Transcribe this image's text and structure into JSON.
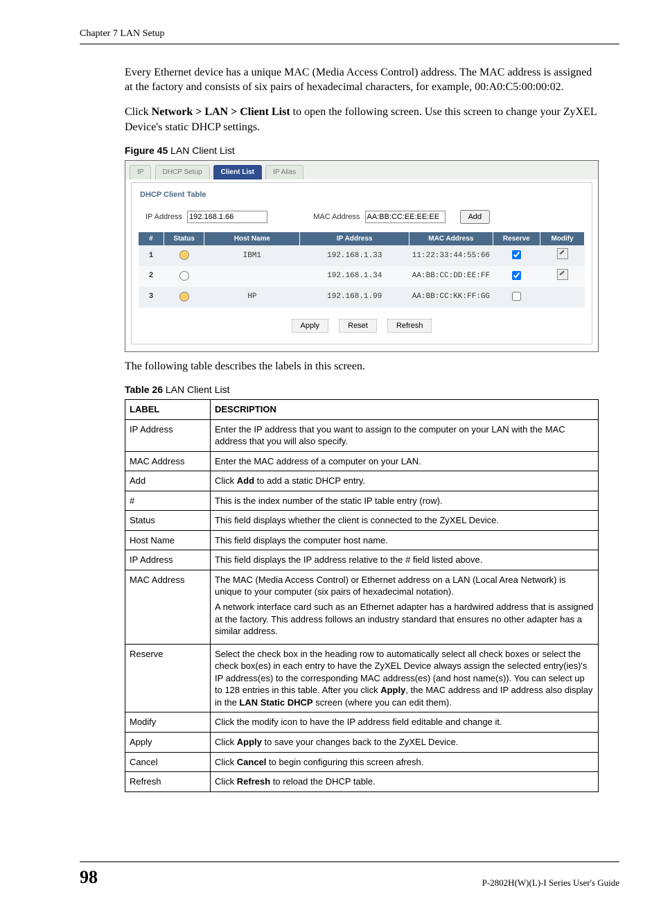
{
  "header": {
    "chapter": "Chapter 7 LAN Setup"
  },
  "paras": {
    "p1": "Every Ethernet device has a unique MAC (Media Access Control) address. The MAC address is assigned at the factory and consists of six pairs of hexadecimal characters, for example, 00:A0:C5:00:00:02.",
    "p2_pre": "Click ",
    "p2_bold": "Network > LAN > Client List",
    "p2_post": " to open the following screen. Use this screen to change your ZyXEL Device's static DHCP settings.",
    "p3": "The following table describes the labels in this screen."
  },
  "figcap": {
    "num": "Figure 45",
    "title": "   LAN Client List"
  },
  "tabs": [
    "IP",
    "DHCP Setup",
    "Client List",
    "IP Alias"
  ],
  "panel": {
    "title": "DHCP Client Table",
    "ip_label": "IP Address",
    "ip_value": "192.168.1.66",
    "mac_label": "MAC Address",
    "mac_value": "AA:BB:CC:EE:EE:EE",
    "add": "Add",
    "cols": [
      "#",
      "Status",
      "Host Name",
      "IP Address",
      "MAC Address",
      "Reserve",
      "Modify"
    ],
    "rows": [
      {
        "n": "1",
        "on": true,
        "host": "IBM1",
        "ip": "192.168.1.33",
        "mac": "11:22:33:44:55:66",
        "reserve": true,
        "modify": true
      },
      {
        "n": "2",
        "on": false,
        "host": "",
        "ip": "192.168.1.34",
        "mac": "AA:BB:CC:DD:EE:FF",
        "reserve": true,
        "modify": true
      },
      {
        "n": "3",
        "on": true,
        "host": "HP",
        "ip": "192.168.1.99",
        "mac": "AA:BB:CC:KK:FF:GG",
        "reserve": false,
        "modify": false
      }
    ],
    "btns": {
      "apply": "Apply",
      "reset": "Reset",
      "refresh": "Refresh"
    }
  },
  "tabcap": {
    "num": "Table 26",
    "title": "   LAN Client List"
  },
  "desc": {
    "head": [
      "LABEL",
      "DESCRIPTION"
    ],
    "rows": [
      {
        "label": "IP Address",
        "desc": "Enter the IP address that you want to assign to the computer on your LAN with the MAC address that you will also specify."
      },
      {
        "label": "MAC Address",
        "desc": "Enter the MAC address of a computer on your LAN."
      },
      {
        "label": "Add",
        "desc_parts": [
          "Click ",
          "Add",
          " to add a static DHCP entry."
        ]
      },
      {
        "label": "#",
        "desc": "This is the index number of the static IP table entry (row)."
      },
      {
        "label": "Status",
        "desc": "This field displays whether the client is connected to the ZyXEL Device."
      },
      {
        "label": "Host Name",
        "desc": "This field displays the computer host name."
      },
      {
        "label": "IP Address",
        "desc": "This field displays the IP address relative to the # field listed above."
      },
      {
        "label": "MAC Address",
        "desc_multi": [
          "The MAC (Media Access Control) or Ethernet address on a LAN (Local Area Network) is unique to your computer (six pairs of hexadecimal notation).",
          "A network interface card such as an Ethernet adapter has a hardwired address that is assigned at the factory. This address follows an industry standard that ensures no other adapter has a similar address."
        ]
      },
      {
        "label": "Reserve",
        "desc_parts": [
          "Select the check box in the heading row to automatically select all check boxes or select the check box(es) in each entry to have the ZyXEL Device always assign the selected entry(ies)'s IP address(es) to the corresponding MAC address(es) (and host name(s)). You can select up to 128 entries in this table. After you click ",
          "Apply",
          ", the MAC address and IP address also display in the ",
          "LAN Static DHCP",
          " screen (where you can edit them)."
        ]
      },
      {
        "label": "Modify",
        "desc": "Click the modify icon to have the IP address field editable and change it."
      },
      {
        "label": "Apply",
        "desc_parts": [
          "Click ",
          "Apply",
          " to save your changes back to the ZyXEL Device."
        ]
      },
      {
        "label": "Cancel",
        "desc_parts": [
          "Click ",
          "Cancel",
          " to begin configuring this screen afresh."
        ]
      },
      {
        "label": "Refresh",
        "desc_parts": [
          "Click ",
          "Refresh",
          " to reload the DHCP table."
        ]
      }
    ]
  },
  "footer": {
    "page": "98",
    "guide": "P-2802H(W)(L)-I Series User's Guide"
  }
}
